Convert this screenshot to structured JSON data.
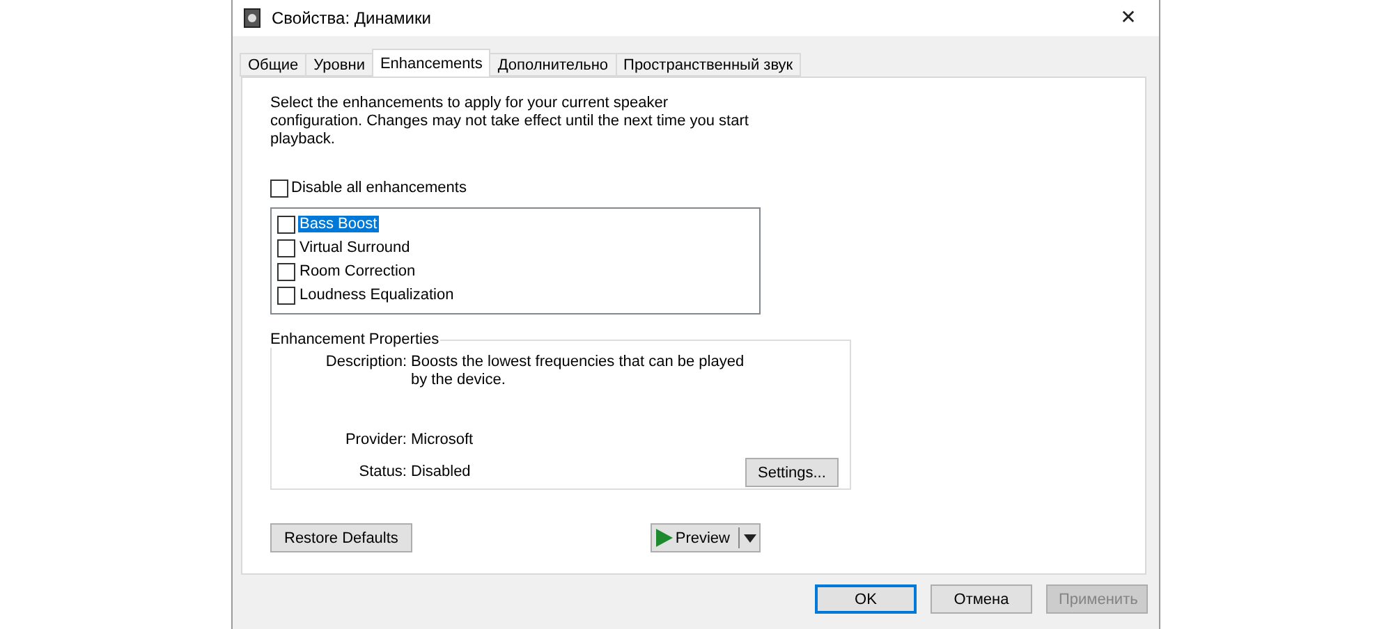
{
  "window": {
    "title": "Свойства: Динамики",
    "close": "✕"
  },
  "tabs": [
    {
      "label": "Общие",
      "selected": false
    },
    {
      "label": "Уровни",
      "selected": false
    },
    {
      "label": "Enhancements",
      "selected": true
    },
    {
      "label": "Дополнительно",
      "selected": false
    },
    {
      "label": "Пространственный звук",
      "selected": false
    }
  ],
  "intro": "Select the enhancements to apply for your current speaker configuration. Changes may not take effect until the next time you start playback.",
  "disable_all": {
    "label": "Disable all enhancements",
    "checked": false
  },
  "enhancements": [
    {
      "label": "Bass Boost",
      "checked": false,
      "selected": true
    },
    {
      "label": "Virtual Surround",
      "checked": false,
      "selected": false
    },
    {
      "label": "Room Correction",
      "checked": false,
      "selected": false
    },
    {
      "label": "Loudness Equalization",
      "checked": false,
      "selected": false
    }
  ],
  "properties": {
    "legend": "Enhancement Properties",
    "fields": [
      {
        "label": "Description:",
        "value": "Boosts the lowest frequencies that can be played by the device."
      },
      {
        "label": "Provider:",
        "value": "Microsoft"
      },
      {
        "label": "Status:",
        "value": "Disabled"
      }
    ],
    "settings_button": "Settings..."
  },
  "restore_button": "Restore Defaults",
  "preview_button": "Preview",
  "buttons": [
    {
      "label": "OK",
      "default": true,
      "disabled": false
    },
    {
      "label": "Отмена",
      "default": false,
      "disabled": false
    },
    {
      "label": "Применить",
      "default": false,
      "disabled": true
    }
  ]
}
